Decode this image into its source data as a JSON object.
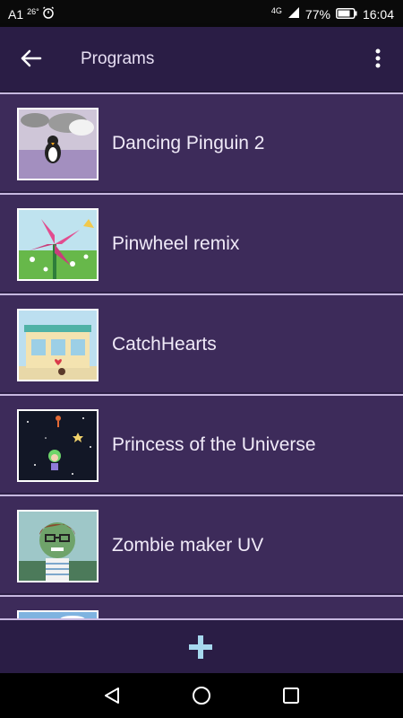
{
  "status_bar": {
    "carrier": "A1",
    "temperature": "26°",
    "network": "4G",
    "battery": "77%",
    "time": "16:04"
  },
  "app_bar": {
    "title": "Programs"
  },
  "programs": [
    {
      "name": "Dancing Pinguin 2"
    },
    {
      "name": "Pinwheel remix"
    },
    {
      "name": "CatchHearts"
    },
    {
      "name": "Princess of the Universe"
    },
    {
      "name": "Zombie maker UV"
    }
  ],
  "icons": {
    "back": "arrow-left-icon",
    "menu": "more-vert-icon",
    "add": "plus-icon",
    "nav_back": "triangle-back-icon",
    "nav_home": "circle-home-icon",
    "nav_recent": "square-recent-icon"
  },
  "colors": {
    "background": "#2e2047",
    "app_bar": "#2a1d45",
    "row": "#3d2b5a",
    "divider": "#c7b8e0",
    "add_button": "#a6d8ee"
  }
}
